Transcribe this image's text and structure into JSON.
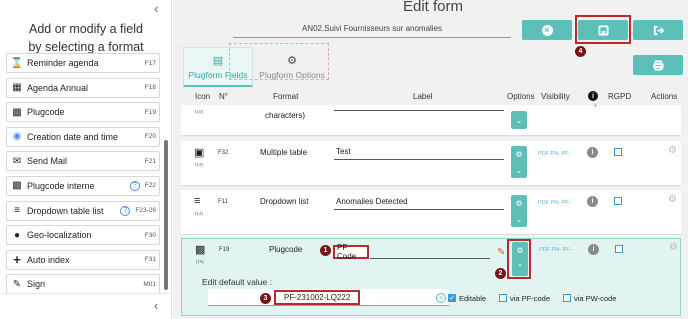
{
  "sidebar": {
    "title_line1": "Add or modify a field",
    "title_line2": "by selecting a format",
    "collapse_icon": "chevron-left-icon",
    "items": [
      {
        "label": "Reminder agenda",
        "code": "F17",
        "icon": "hourglass-icon",
        "help": false
      },
      {
        "label": "Agenda Annual",
        "code": "F18",
        "icon": "calendar-icon",
        "help": false
      },
      {
        "label": "Plugcode",
        "code": "F19",
        "icon": "qr-icon",
        "help": false
      },
      {
        "label": "Creation date and time",
        "code": "F20",
        "icon": "clock-icon",
        "help": false
      },
      {
        "label": "Send Mail",
        "code": "F21",
        "icon": "mail-icon",
        "help": false
      },
      {
        "label": "Plugcode interne",
        "code": "F22",
        "icon": "qr-icon",
        "help": true
      },
      {
        "label": "Dropdown table list",
        "code": "F23-26",
        "icon": "list-icon",
        "help": true
      },
      {
        "label": "Geo-localization",
        "code": "F30",
        "icon": "pin-icon",
        "help": false
      },
      {
        "label": "Auto index",
        "code": "F31",
        "icon": "plus-icon",
        "help": false
      },
      {
        "label": "Sign",
        "code": "M01",
        "icon": "sign-icon",
        "help": false
      }
    ]
  },
  "header": {
    "title": "Edit form",
    "form_name": "AN02.Suivi Fournisseurs sur anomalies",
    "buttons": [
      "close-icon",
      "save-icon",
      "exit-icon",
      "print-icon"
    ]
  },
  "tabs": [
    {
      "label": "Plugform Fields",
      "active": true
    },
    {
      "label": "Plugform Options",
      "active": false
    }
  ],
  "table": {
    "headers": {
      "icon": "Icon",
      "number": "N°",
      "format": "Format",
      "label": "Label",
      "options": "Options",
      "visibility": "Visibility",
      "info": "i",
      "rgpd": "RGPD",
      "actions": "Actions"
    },
    "rows": [
      {
        "icon_num": "(10)",
        "format": "characters)",
        "num": "",
        "label": ""
      },
      {
        "icon_num": "(13)",
        "num": "F32",
        "format": "Multiple table",
        "label": "Test",
        "visibility": "PDF PN- PF-"
      },
      {
        "icon_num": "(14)",
        "num": "F11",
        "format": "Dropdown list",
        "label": "Anomalies Detected",
        "visibility": "PDF PN- PF-"
      },
      {
        "icon_num": "(15)",
        "num": "F19",
        "format": "Plugcode",
        "label": "PF Code",
        "visibility": "PDF PN- PF-"
      }
    ]
  },
  "edit_panel": {
    "label": "Edit default value :",
    "value": "PF-231002-LQ222",
    "checkboxes": [
      {
        "label": "Editable",
        "checked": true
      },
      {
        "label": "via PF-code",
        "checked": false
      },
      {
        "label": "via PW-code",
        "checked": false
      }
    ]
  },
  "markers": [
    "1",
    "2",
    "3",
    "4"
  ],
  "colors": {
    "accent": "#5cbfb8",
    "highlight": "#b42c2c",
    "visibility": "#5ab3d6"
  }
}
